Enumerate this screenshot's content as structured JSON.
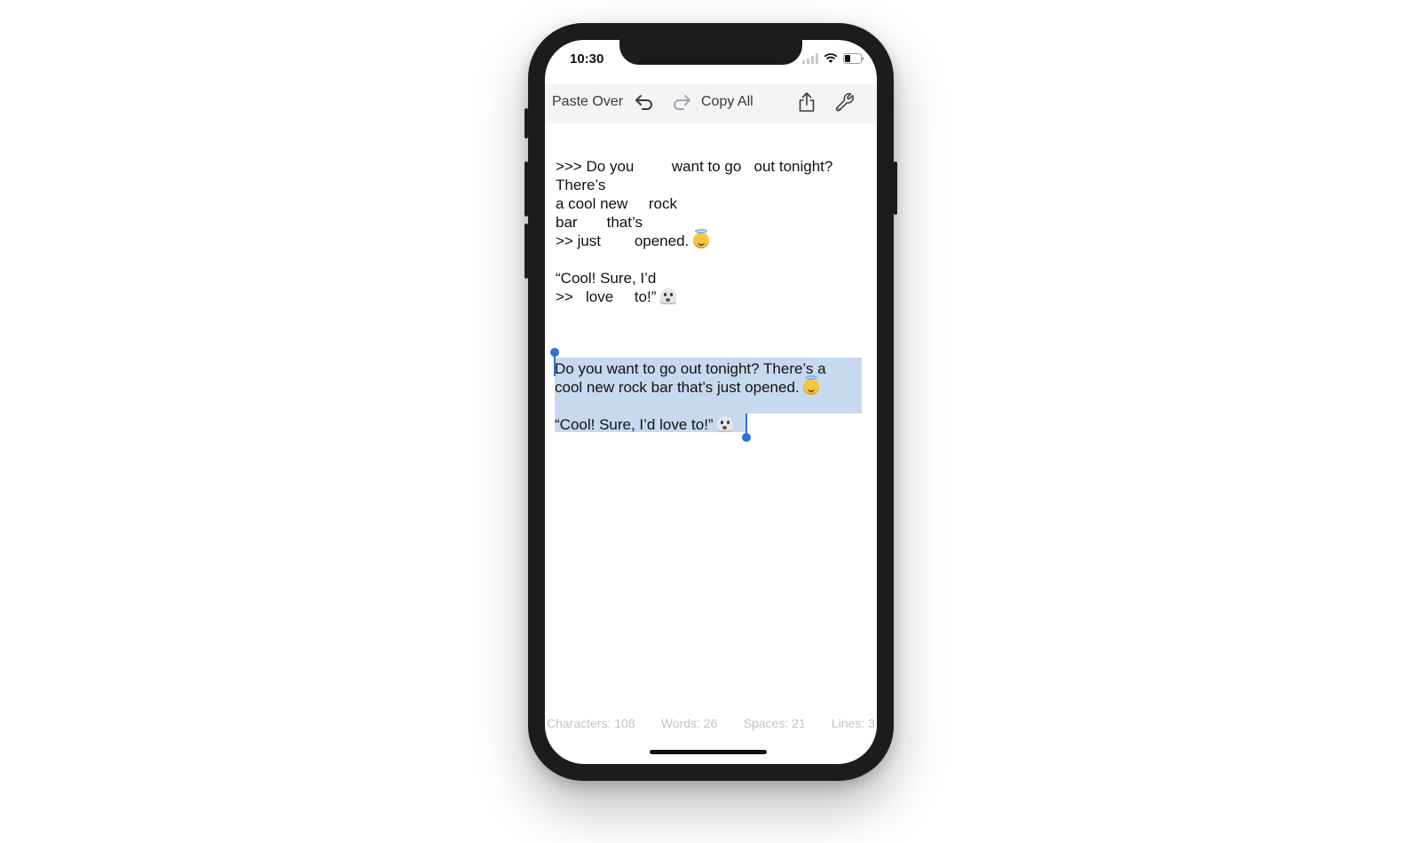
{
  "status": {
    "time": "10:30"
  },
  "toolbar": {
    "paste_over": "Paste Over",
    "copy_all": "Copy All",
    "icons": [
      "undo-icon",
      "redo-icon",
      "share-icon",
      "wrench-icon"
    ]
  },
  "quoted": {
    "l1": ">>> Do you         want to go   out tonight?",
    "l2": "There’s",
    "l3": "a cool new     rock",
    "l4": "bar       that’s",
    "l5": ">> just        opened.",
    "l6": "“Cool! Sure, I’d",
    "l7": ">>   love     to!”"
  },
  "cleaned": {
    "l1": "Do you want to go out tonight? There’s a",
    "l2": "cool new rock bar that’s just opened.",
    "l3": "“Cool! Sure, I’d love to!”"
  },
  "stats": {
    "characters": "Characters: 108",
    "words": "Words: 26",
    "spaces": "Spaces: 21",
    "lines": "Lines: 3"
  },
  "colors": {
    "selection": "#c6d9ee",
    "handle": "#2f6fd5",
    "toolbar_bg": "#f4f4f6"
  }
}
